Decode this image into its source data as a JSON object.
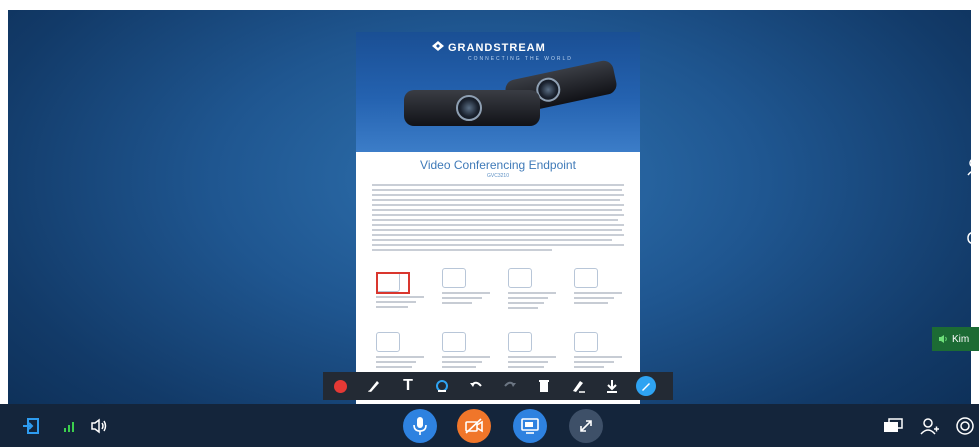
{
  "document": {
    "brand": "GRANDSTREAM",
    "brand_tagline": "CONNECTING THE WORLD",
    "title": "Video Conferencing Endpoint",
    "model": "GVC3210"
  },
  "annotation_toolbar": {
    "tools": [
      "record-icon",
      "brush-icon",
      "text-icon",
      "highlighter-icon",
      "undo-icon",
      "redo-icon",
      "delete-icon",
      "eraser-icon",
      "download-icon",
      "pen-color-icon"
    ],
    "text_tool_label": "T"
  },
  "bottom_bar": {
    "left": [
      "exit-icon",
      "signal-icon",
      "speaker-icon"
    ],
    "center": [
      "microphone-icon",
      "camera-off-icon",
      "screen-share-icon",
      "fullscreen-icon"
    ],
    "right": [
      "layout-icon",
      "participants-icon",
      "settings-icon"
    ]
  },
  "speaker_indicator": {
    "name": "Kim"
  },
  "colors": {
    "mic": "#2e82e0",
    "camera_off": "#f0762a",
    "screen_share": "#2e82e0",
    "fullscreen": "#3e5068",
    "record": "#e53935",
    "highlight_box": "#d9362e",
    "speaker_tag": "#1c6b34"
  }
}
